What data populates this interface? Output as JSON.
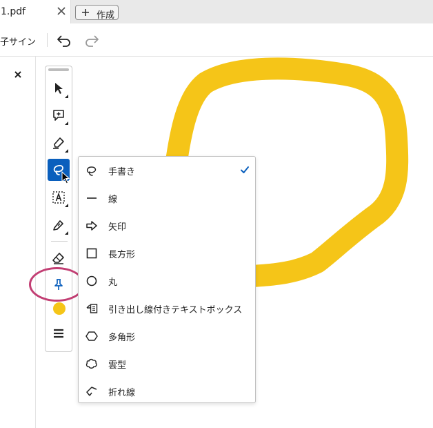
{
  "tab": {
    "title": "1.pdf",
    "new_tab_label": "作成",
    "close_icon": "close-icon",
    "plus_icon": "plus-icon"
  },
  "command_bar": {
    "label": "子サイン",
    "undo_icon": "undo-icon",
    "redo_icon": "redo-icon"
  },
  "tools": [
    {
      "name": "select",
      "icon": "pointer-icon"
    },
    {
      "name": "comment",
      "icon": "add-comment-icon"
    },
    {
      "name": "highlight",
      "icon": "highlighter-icon"
    },
    {
      "name": "draw",
      "icon": "lasso-icon",
      "active": true
    },
    {
      "name": "text-box",
      "icon": "text-box-icon"
    },
    {
      "name": "sign",
      "icon": "pen-sign-icon"
    },
    {
      "name": "eraser",
      "icon": "eraser-icon"
    },
    {
      "name": "pin",
      "icon": "pin-icon"
    },
    {
      "name": "color",
      "icon": "color-swatch",
      "color": "#f5c518"
    },
    {
      "name": "line-weight",
      "icon": "line-weight-icon"
    }
  ],
  "menu": {
    "items": [
      {
        "label": "手書き",
        "icon": "freehand-icon",
        "checked": true
      },
      {
        "label": "線",
        "icon": "line-icon"
      },
      {
        "label": "矢印",
        "icon": "arrow-icon"
      },
      {
        "label": "長方形",
        "icon": "rectangle-icon"
      },
      {
        "label": "丸",
        "icon": "circle-icon"
      },
      {
        "label": "引き出し線付きテキストボックス",
        "icon": "callout-icon"
      },
      {
        "label": "多角形",
        "icon": "polygon-icon"
      },
      {
        "label": "雲型",
        "icon": "cloud-icon"
      },
      {
        "label": "折れ線",
        "icon": "polyline-icon"
      }
    ]
  },
  "colors": {
    "accent": "#0a5fbd",
    "ink": "#f5c518",
    "highlight_ring": "#c23e73",
    "check": "#0a5fbd"
  }
}
